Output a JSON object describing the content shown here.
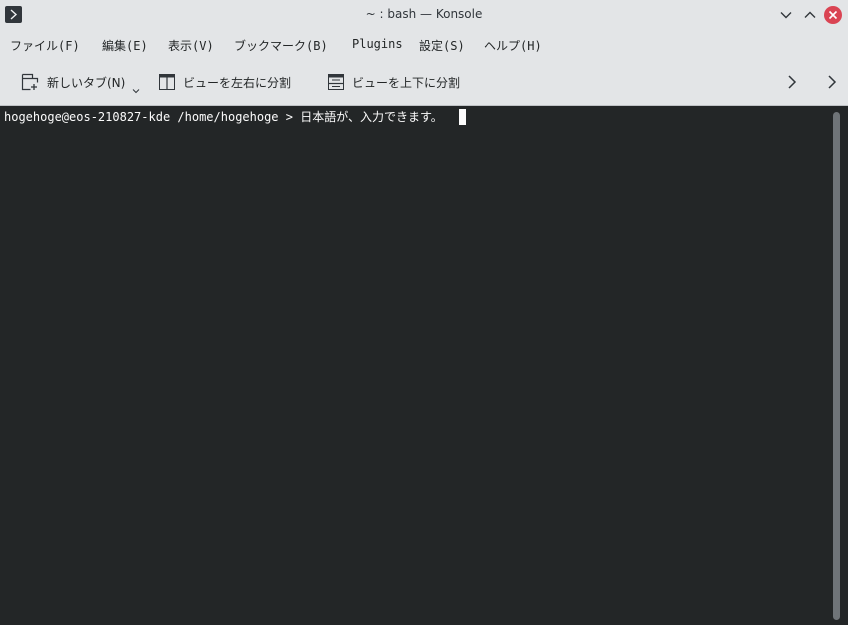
{
  "window": {
    "title": "~ : bash — Konsole"
  },
  "menu": [
    "ファイル(F)",
    "編集(E)",
    "表示(V)",
    "ブックマーク(B)",
    "Plugins",
    "設定(S)",
    "ヘルプ(H)"
  ],
  "toolbar": {
    "new_tab": "新しいタブ(N)",
    "split_left_right": "ビューを左右に分割",
    "split_top_bottom": "ビューを上下に分割"
  },
  "terminal": {
    "prompt": "hogehoge@eos-210827-kde /home/hogehoge > ",
    "input": "日本語が、入力できます。"
  },
  "colors": {
    "chrome_bg": "#e3e5e7",
    "terminal_bg": "#232627",
    "terminal_fg": "#fcfcfc",
    "close_button": "#da4453"
  },
  "icons": {
    "app": "konsole-icon",
    "minimize": "chevron-down-icon",
    "maximize": "chevron-up-icon",
    "close": "close-icon",
    "new_tab": "tab-new-icon",
    "split_lr": "split-left-right-icon",
    "split_tb": "split-top-bottom-icon",
    "overflow": "chevron-right-icon"
  }
}
